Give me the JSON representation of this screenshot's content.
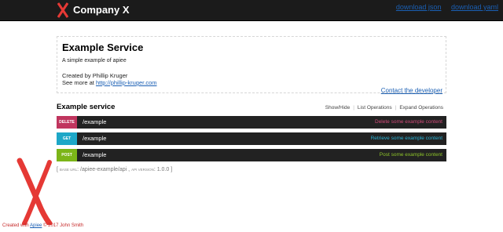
{
  "header": {
    "brand": "Company X",
    "links": [
      "download json",
      "download yaml"
    ],
    "brand_color": "#e53935"
  },
  "info": {
    "title": "Example Service",
    "description": "A simple example of apiee",
    "author": "Created by Phillip Kruger",
    "more_prefix": "See more at ",
    "more_link": "http://phillip-kruger.com",
    "contact": "Contact the developer"
  },
  "service": {
    "title": "Example service",
    "show_hide": "Show/Hide",
    "list_ops": "List Operations",
    "expand_ops": "Expand Operations"
  },
  "operations": [
    {
      "verb": "DELETE",
      "path": "/example",
      "summary": "Delete some example content",
      "color": "#c0355e",
      "summary_color": "#d24b7a"
    },
    {
      "verb": "GET",
      "path": "/example",
      "summary": "Retrieve some example content",
      "color": "#1da7c7",
      "summary_color": "#2ab3d6"
    },
    {
      "verb": "POST",
      "path": "/example",
      "summary": "Post some example content",
      "color": "#7cb518",
      "summary_color": "#8fc62a"
    }
  ],
  "base": {
    "open": "[",
    "base_url_label": "base url",
    "base_url": ": /apiee-example/api ,",
    "api_version_label": "api version",
    "api_version": ": 1.0.0",
    "close": "]"
  },
  "footer": {
    "created_with": "Created with ",
    "link": "Apiee",
    "copyright": " © 2017 John Smith"
  }
}
